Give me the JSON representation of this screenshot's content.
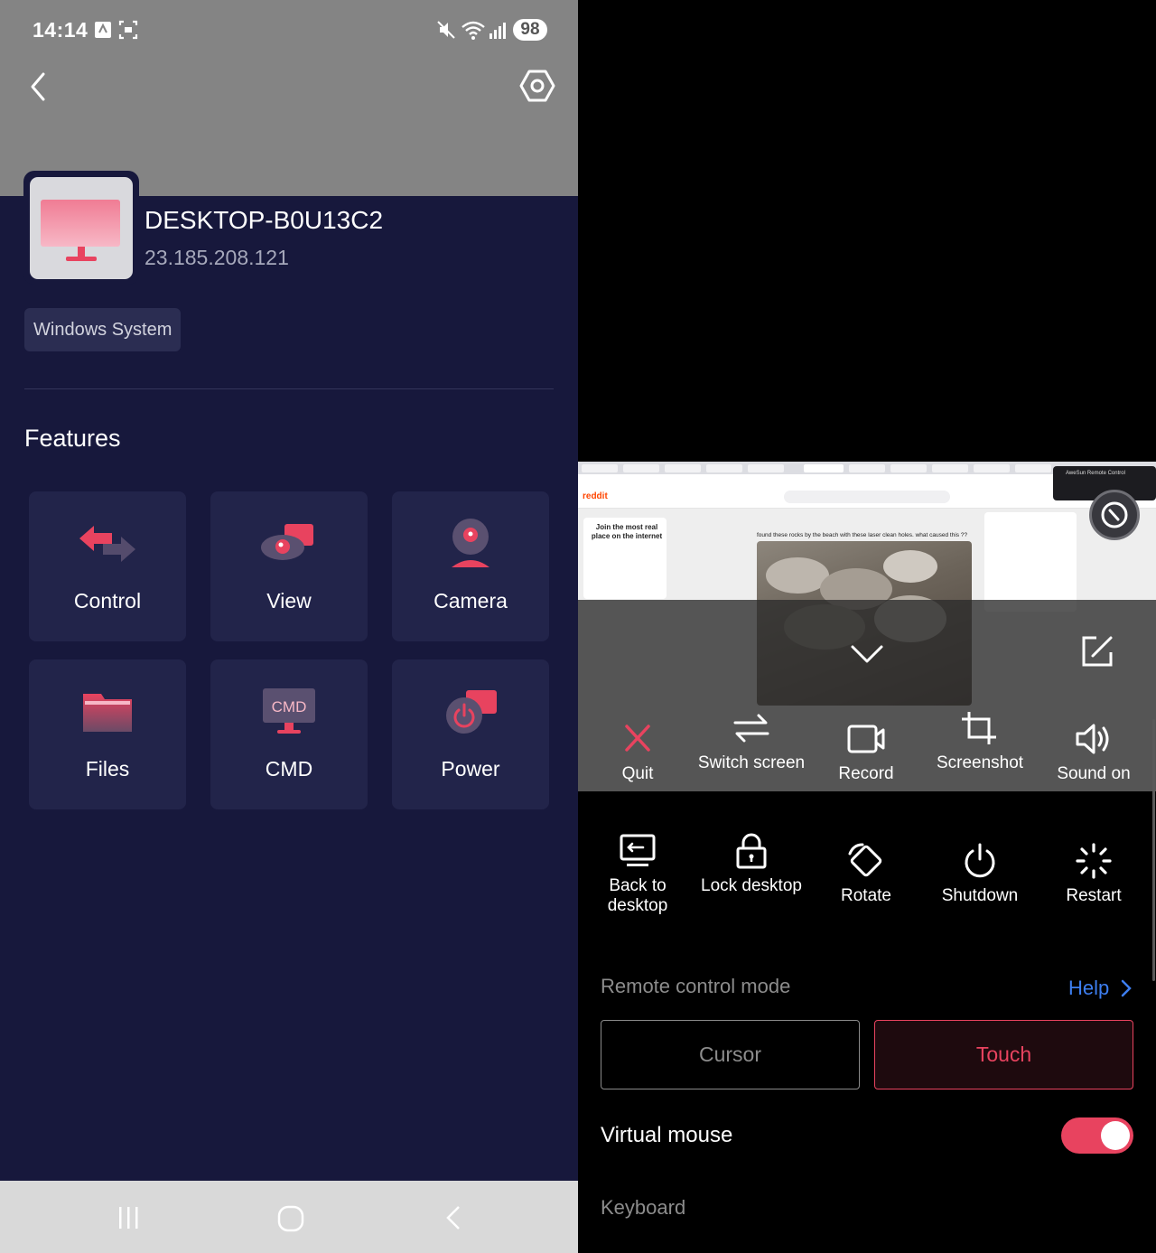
{
  "status_bar": {
    "time": "14:14",
    "battery": "98"
  },
  "device": {
    "name": "DESKTOP-B0U13C2",
    "ip": "23.185.208.121",
    "os": "Windows System"
  },
  "features": {
    "title": "Features",
    "items": [
      {
        "label": "Control",
        "icon": "control-arrows-icon"
      },
      {
        "label": "View",
        "icon": "view-eye-icon"
      },
      {
        "label": "Camera",
        "icon": "camera-icon"
      },
      {
        "label": "Files",
        "icon": "folder-icon"
      },
      {
        "label": "CMD",
        "icon": "cmd-monitor-icon"
      },
      {
        "label": "Power",
        "icon": "power-icon"
      }
    ],
    "cmd_badge": "CMD"
  },
  "remote_view": {
    "site_logo": "reddit",
    "join_text": "Join the most real place on the internet",
    "post_title": "found these rocks by the beach with these laser clean holes. what caused this ??",
    "popup_title": "AweSun Remote Control"
  },
  "toolbar": {
    "row1": [
      {
        "label": "Quit",
        "icon": "close-x-icon"
      },
      {
        "label": "Switch screen",
        "icon": "switch-arrows-icon"
      },
      {
        "label": "Record",
        "icon": "video-record-icon"
      },
      {
        "label": "Screenshot",
        "icon": "crop-icon"
      },
      {
        "label": "Sound on",
        "icon": "speaker-icon"
      }
    ],
    "row2": [
      {
        "label": "Back to desktop",
        "icon": "back-to-desktop-icon"
      },
      {
        "label": "Lock desktop",
        "icon": "lock-icon"
      },
      {
        "label": "Rotate",
        "icon": "rotate-icon"
      },
      {
        "label": "Shutdown",
        "icon": "power-icon"
      },
      {
        "label": "Restart",
        "icon": "restart-spinner-icon"
      }
    ]
  },
  "remote_control": {
    "mode_label": "Remote control mode",
    "help_label": "Help",
    "cursor_label": "Cursor",
    "touch_label": "Touch",
    "selected_mode": "Touch",
    "virtual_mouse_label": "Virtual mouse",
    "virtual_mouse_on": true,
    "keyboard_label": "Keyboard"
  },
  "colors": {
    "accent": "#e8435f",
    "panel_bg": "#17183c",
    "tile_bg": "#22244a",
    "link": "#3d7ef0"
  }
}
